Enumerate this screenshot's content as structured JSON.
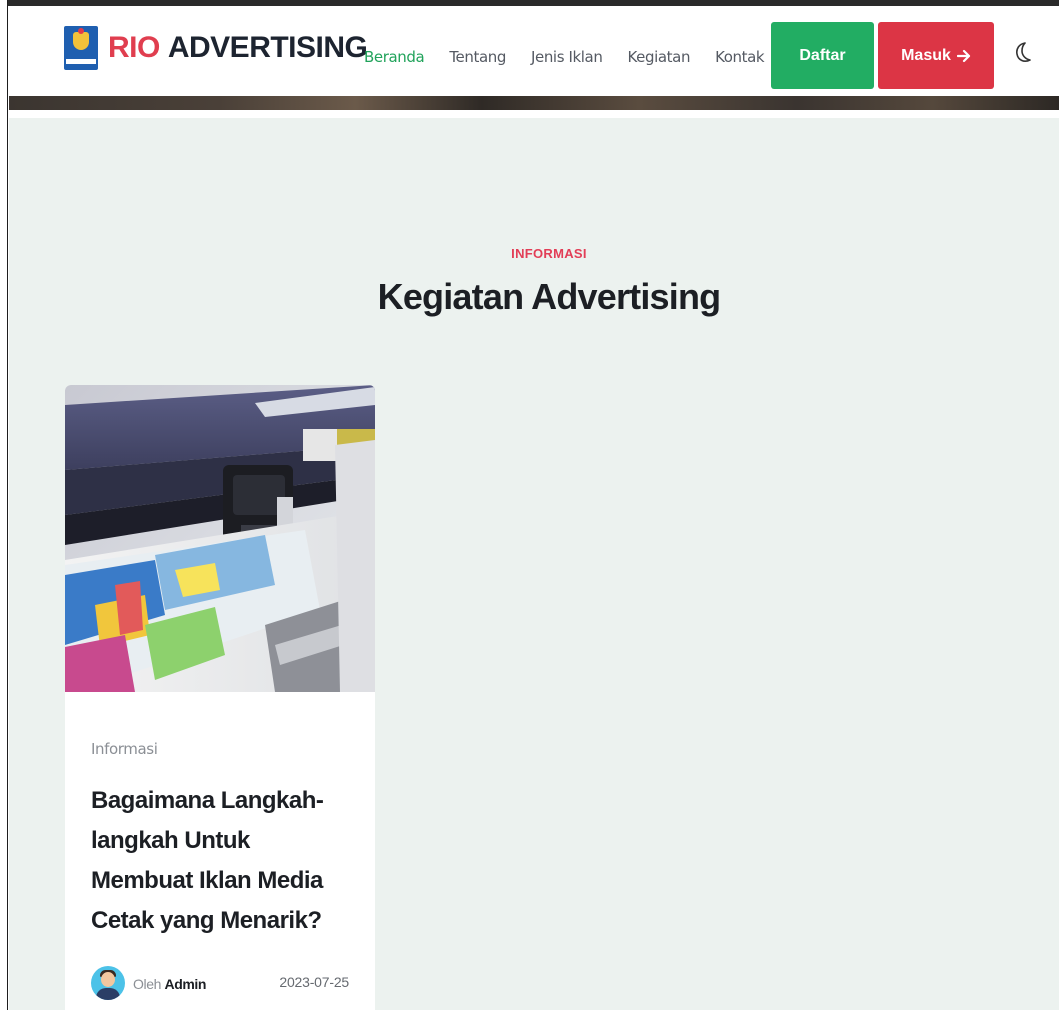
{
  "brand": {
    "name_accent": "RIO",
    "name_rest": "ADVERTISING",
    "logo_icon": "trophy-logo-icon"
  },
  "nav": {
    "items": [
      {
        "label": "Beranda",
        "active": true
      },
      {
        "label": "Tentang",
        "active": false
      },
      {
        "label": "Jenis Iklan",
        "active": false
      },
      {
        "label": "Kegiatan",
        "active": false
      },
      {
        "label": "Kontak",
        "active": false
      }
    ]
  },
  "actions": {
    "register_label": "Daftar",
    "login_label": "Masuk",
    "login_icon": "arrow-right-icon",
    "theme_icon": "moon-icon"
  },
  "section": {
    "eyebrow": "INFORMASI",
    "title": "Kegiatan Advertising"
  },
  "posts": [
    {
      "image_icon": "large-format-printer-photo",
      "category": "Informasi",
      "title": "Bagaimana Langkah-langkah Untuk Membuat Iklan Media Cetak yang Menarik?",
      "author_prefix": "Oleh",
      "author": "Admin",
      "date": "2023-07-25"
    }
  ],
  "colors": {
    "brand_red": "#e03e4f",
    "accent_green": "#22ad63",
    "login_red": "#dc3545",
    "eyebrow_red": "#e23e57",
    "section_bg": "#ecf2ef"
  }
}
